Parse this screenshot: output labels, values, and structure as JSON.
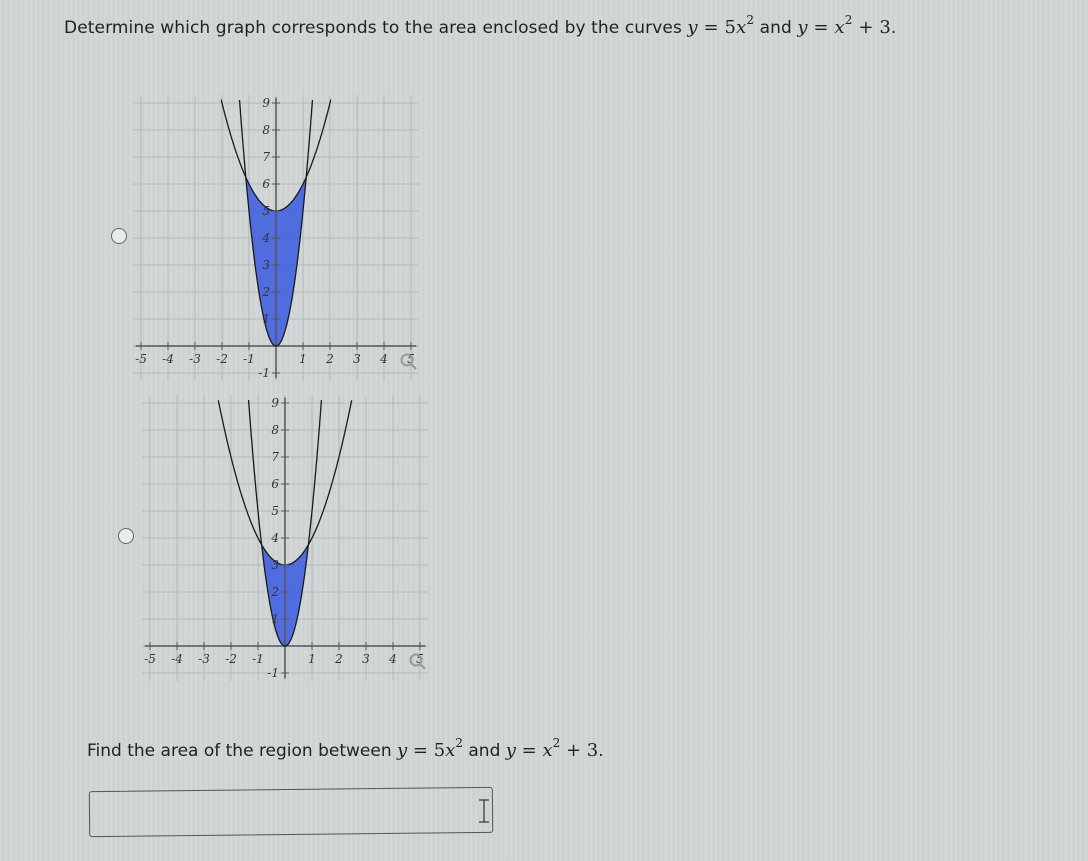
{
  "question1": {
    "prefix": "Determine which graph corresponds to the area enclosed by the curves ",
    "curve1": {
      "lhs": "y",
      "eq": " = ",
      "rhs_coef": "5",
      "rhs_var": "x",
      "exp": "2",
      "rest": ""
    },
    "joiner": " and ",
    "curve2": {
      "lhs": "y",
      "eq": " = ",
      "rhs_coef": "",
      "rhs_var": "x",
      "exp": "2",
      "rest": " + 3"
    },
    "suffix": "."
  },
  "options": [
    {
      "id": "option-a",
      "selected": false,
      "graph": {
        "curves": [
          "y = 5x^2",
          "y = x^2 + 5"
        ],
        "shaded_between": true,
        "fill_color": "#3a5be0",
        "xlim": [
          -5,
          5
        ],
        "ylim": [
          -1,
          9
        ],
        "x_ticks": [
          "-5",
          "-4",
          "-3",
          "-2",
          "-1",
          "1",
          "2",
          "3",
          "4",
          "5"
        ],
        "y_ticks": [
          "-1",
          "1",
          "2",
          "3",
          "4",
          "5",
          "6",
          "7",
          "8",
          "9"
        ],
        "zoom_icon": "magnifier-icon"
      }
    },
    {
      "id": "option-b",
      "selected": false,
      "graph": {
        "curves": [
          "y = 5x^2",
          "y = x^2 + 3"
        ],
        "shaded_between": true,
        "fill_color": "#3a5be0",
        "xlim": [
          -5,
          5
        ],
        "ylim": [
          -1,
          9
        ],
        "x_ticks": [
          "-5",
          "-4",
          "-3",
          "-2",
          "-1",
          "1",
          "2",
          "3",
          "4",
          "5"
        ],
        "y_ticks": [
          "-1",
          "1",
          "2",
          "3",
          "4",
          "5",
          "6",
          "7",
          "8",
          "9"
        ],
        "zoom_icon": "magnifier-icon"
      }
    }
  ],
  "question2": {
    "prefix": "Find the area of the region between ",
    "curve1": {
      "lhs": "y",
      "eq": " = ",
      "rhs_coef": "5",
      "rhs_var": "x",
      "exp": "2",
      "rest": ""
    },
    "joiner": " and ",
    "curve2": {
      "lhs": "y",
      "eq": " = ",
      "rhs_coef": "",
      "rhs_var": "x",
      "exp": "2",
      "rest": " + 3"
    },
    "suffix": "."
  },
  "answer": {
    "value": "",
    "placeholder": ""
  }
}
